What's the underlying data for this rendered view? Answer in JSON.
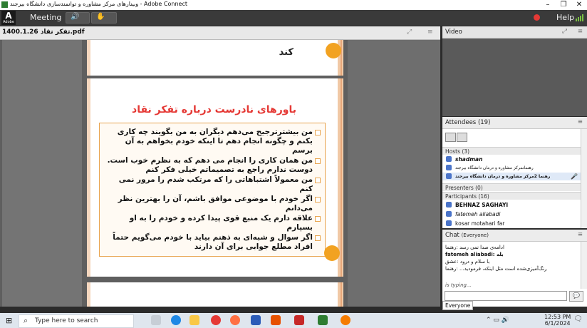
{
  "window": {
    "title": "وبینارهای مرکز مشاوره و توانمندسازی دانشگاه بیرجند - Adobe Connect",
    "minimize": "–",
    "maximize": "❐",
    "close": "✕"
  },
  "menubar": {
    "logo_text": "A",
    "logo_sub": "Adobe",
    "meeting_label": "Meeting",
    "help_label": "Help"
  },
  "share_pod": {
    "filename": "1400.1.26 تفکر نقاد.pdf",
    "page1_text": "کند",
    "slide_title": "باورهای نادرست درباره تفکر نقاد",
    "slide_items": [
      "من بیشترترجیح می‌دهم دیگران به من بگویند چه کاری بکنم و چگونه انجام دهم تا اینکه خودم بخواهم به آن برسم",
      "من همان کاری را انجام می دهم که به نظرم خوب است. دوست ندارم راجع به تصمیماتم خیلی فکر کنم",
      "من معمولاً اشتباهاتی را که مرتکب شدم را مرور نمی کنم",
      "اگر خودم با موضوعی موافق باشم، آن را بهترین نظر می‌دانم",
      "علاقه دارم یک منبع قوی پیدا کرده و خودم را به او بسپارم",
      "اگر سوال و شبه‌ای به ذهنم بیاید با خودم می‌گویم حتماً افراد مطلع جوابی برای آن دارند"
    ]
  },
  "video_pod": {
    "title": "Video"
  },
  "attendees_pod": {
    "title": "Attendees",
    "count": "(19)",
    "hosts_label": "Hosts (3)",
    "hosts": [
      "shadman",
      "رهنمانمرکز مشاوره و درمان دانشگاه بیرجند",
      "رهنما 2مرکز مشاوره و درمان دانشگاه بیرجند"
    ],
    "presenters_label": "Presenters (0)",
    "participants_label": "Participants (16)",
    "participants": [
      "BEHNAZ SAGHAYI",
      "fatemeh aliabadi",
      "kosar motahari far"
    ]
  },
  "chat_pod": {
    "title": "Chat",
    "scope": "(Everyone)",
    "messages": [
      "ادامه‌ی صدا نمی ‌رسد :رهنما",
      "fatemeh aliabadi: بله",
      "با سلام و درود :عشق",
      "رنگ‌آمیزی‌شده است مثل اینکه، فرمودید... :رهنما",
      "is typing..."
    ],
    "tab_label": "Everyone",
    "send_icon": "💬"
  },
  "taskbar": {
    "search_placeholder": "Type here to search",
    "time": "12:53 PM",
    "date": "6/1/2024"
  },
  "colors": {
    "slide_title": "#e53935",
    "accent_orange": "#f2a221",
    "record_red": "#e53935"
  }
}
